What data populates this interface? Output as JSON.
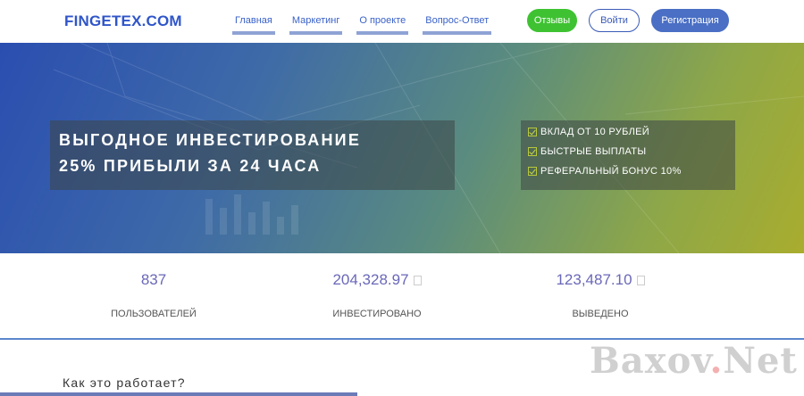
{
  "header": {
    "logo": "FINGETEX.COM",
    "nav": [
      {
        "label": "Главная"
      },
      {
        "label": "Маркетинг"
      },
      {
        "label": "О проекте"
      },
      {
        "label": "Вопрос-Ответ"
      }
    ],
    "reviews_label": "Отзывы",
    "login_label": "Войти",
    "register_label": "Регистрация"
  },
  "hero": {
    "line1": "ВЫГОДНОЕ ИНВЕСТИРОВАНИЕ",
    "line2": "25% ПРИБЫЛИ ЗА 24 ЧАСА",
    "features": [
      "ВКЛАД ОТ 10 РУБЛЕЙ",
      "БЫСТРЫЕ ВЫПЛАТЫ",
      "РЕФЕРАЛЬНЫЙ БОНУС 10%"
    ]
  },
  "stats": [
    {
      "value": "837",
      "label": "ПОЛЬЗОВАТЕЛЕЙ"
    },
    {
      "value": "204,328.97",
      "label": "ИНВЕСТИРОВАНО"
    },
    {
      "value": "123,487.10",
      "label": "ВЫВЕДЕНО"
    }
  ],
  "how": {
    "title": "Как это работает?"
  },
  "watermark": {
    "part1": "Baxov",
    "dot": ".",
    "part2": "Net"
  },
  "colors": {
    "brand": "#2f55c9",
    "green": "#3fc232",
    "accent": "#4a6fc4"
  }
}
